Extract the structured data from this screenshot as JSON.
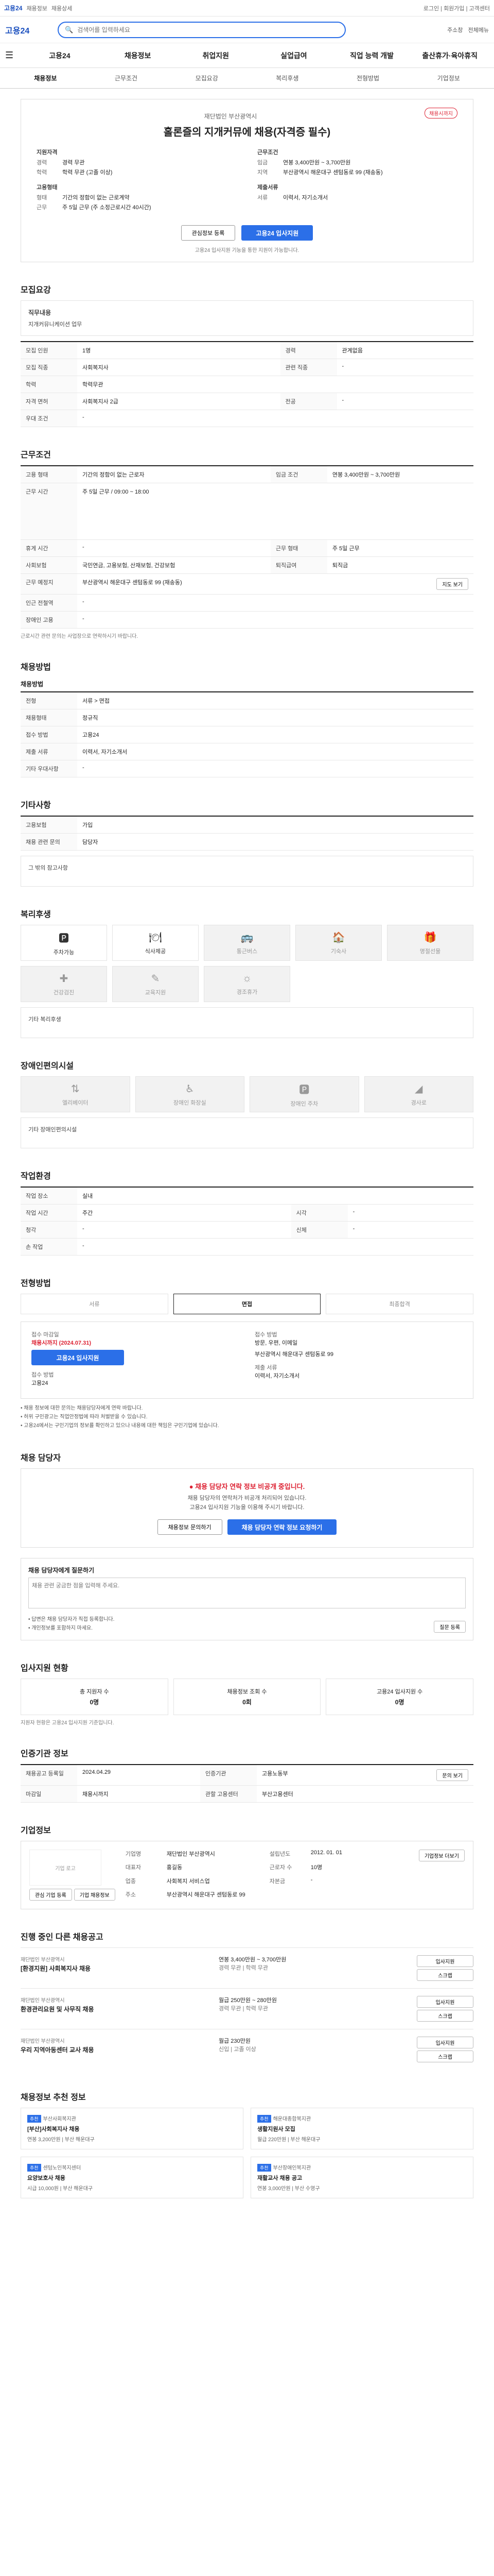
{
  "topbar": {
    "site": "고용24",
    "notice": "채용정보",
    "tab": "채용상세",
    "links": "로그인 | 회원가입 | 고객센터"
  },
  "search": {
    "brand": "고용24",
    "placeholder": "검색어를 입력하세요",
    "right1": "주소창",
    "right2": "전체메뉴"
  },
  "gnb": [
    "고용24",
    "채용정보",
    "취업지원",
    "실업급여",
    "직업 능력 개발",
    "출산휴가·육아휴직"
  ],
  "tabs": [
    "채용정보",
    "근무조건",
    "모집요강",
    "복리후생",
    "전형방법",
    "기업정보"
  ],
  "job": {
    "badge": "채용시까지",
    "company": "재단법인 부산광역시",
    "title": "홀론즐의 지개커뮤에 채용(자격증 필수)",
    "left_head": "지원자격",
    "left_rows": [
      [
        "경력",
        "경력 무관"
      ],
      [
        "학력",
        "학력 무관 (고졸 이상)"
      ]
    ],
    "right_head": "근무조건",
    "right_rows": [
      [
        "임금",
        "연봉 3,400만원 ~ 3,700만원"
      ],
      [
        "지역",
        "부산광역시 해운대구 센텀동로 99 (재송동)"
      ]
    ],
    "left2_head": "고용형태",
    "left2_rows": [
      [
        "형태",
        "기간의 정함이 없는 근로계약"
      ],
      [
        "근무",
        "주 5일 근무 (주 소정근로시간 40시간)"
      ]
    ],
    "right2_head": "제출서류",
    "right2_rows": [
      [
        "서류",
        "이력서, 자기소개서"
      ]
    ],
    "btn_scrap": "관심정보 등록",
    "btn_apply": "고용24 입사지원",
    "notice": "고용24 입사지원 기능을 통한 지원이 가능합니다."
  },
  "recruit": {
    "title": "모집요강",
    "sub1": "직무내용",
    "desc1": "지개커뮤니케이션 업무",
    "rows": [
      [
        "모집 인원",
        "1명",
        "경력",
        "관계없음"
      ],
      [
        "모집 직종",
        "사회복지사",
        "관련 직종",
        "-"
      ],
      [
        "학력",
        "학력무관",
        "",
        ""
      ],
      [
        "자격 면허",
        "사회복지사 2급",
        "전공",
        "-"
      ],
      [
        "우대 조건",
        "-",
        "",
        ""
      ]
    ]
  },
  "work": {
    "title": "근무조건",
    "rows": [
      [
        "고용 형태",
        "기간의 정함이 없는 근로자",
        "임금 조건",
        "연봉 3,400만원 ~ 3,700만원"
      ],
      [
        "근무 시간",
        "주 5일 근무 / 09:00 ~ 18:00",
        "",
        ""
      ],
      [
        "휴게 시간",
        "-",
        "근무 형태",
        "주 5일 근무"
      ],
      [
        "사회보험",
        "국민연금, 고용보험, 산재보험, 건강보험",
        "퇴직급여",
        "퇴직금"
      ],
      [
        "근무 예정지",
        "부산광역시 해운대구 센텀동로 99 (재송동)",
        "",
        ""
      ],
      [
        "인근 전철역",
        "-",
        "",
        ""
      ],
      [
        "장애인 고용",
        "-",
        "",
        ""
      ]
    ],
    "map_btn": "지도 보기",
    "note": "근로시간 관련 문의는 사업장으로 연락하시기 바랍니다."
  },
  "apply_method": {
    "title": "채용방법",
    "sub1": "채용방법",
    "rows": [
      [
        "전형",
        "서류 > 면접"
      ],
      [
        "채용형태",
        "정규직"
      ],
      [
        "접수 방법",
        "고용24"
      ],
      [
        "제출 서류",
        "이력서, 자기소개서"
      ],
      [
        "기타 우대사항",
        "-"
      ]
    ]
  },
  "other": {
    "title": "기타사항",
    "rows": [
      [
        "고용보험",
        "가입"
      ],
      [
        "채용 관련 문의",
        "담당자"
      ]
    ],
    "text": "그 밖의 참고사항"
  },
  "welfare": {
    "title": "복리후생",
    "items": [
      {
        "icon": "parking",
        "label": "주차가능",
        "on": true
      },
      {
        "icon": "meal",
        "label": "식사제공",
        "on": true
      },
      {
        "icon": "bus",
        "label": "통근버스",
        "on": false
      },
      {
        "icon": "dorm",
        "label": "기숙사",
        "on": false
      },
      {
        "icon": "gift",
        "label": "명절선물",
        "on": false
      },
      {
        "icon": "health",
        "label": "건강검진",
        "on": false
      },
      {
        "icon": "edu",
        "label": "교육지원",
        "on": false
      },
      {
        "icon": "holiday",
        "label": "경조휴가",
        "on": false
      }
    ],
    "more": "기타 복리후생"
  },
  "disability": {
    "title": "장애인편의시설",
    "items": [
      "엘리베이터",
      "장애인 화장실",
      "장애인 주차",
      "경사로"
    ],
    "more": "기타 장애인편의시설"
  },
  "workplace": {
    "title": "작업환경",
    "rows": [
      [
        "작업 장소",
        "실내",
        "",
        ""
      ],
      [
        "작업 시간",
        "주간",
        "시각",
        "-"
      ],
      [
        "청각",
        "-",
        "신체",
        "-"
      ],
      [
        "손 작업",
        "-",
        "",
        ""
      ]
    ]
  },
  "selection": {
    "title": "전형방법",
    "steps": [
      "서류",
      "면접",
      "최종합격"
    ],
    "left_label": "접수 마감일",
    "left_value": "채용시까지 (2024.07.31)",
    "left_btn": "고용24 입사지원",
    "left_method": "접수 방법",
    "left_method_val": "고용24",
    "right_label": "접수 방법",
    "right_value": "방문, 우편, 이메일",
    "right_addr": "부산광역시 해운대구 센텀동로 99",
    "right_docs": "제출 서류",
    "right_docs_val": "이력서, 자기소개서",
    "bullets": [
      "채용 정보에 대한 문의는 채용담당자에게 연락 바랍니다.",
      "허위 구인광고는 직업안정법에 따라 처벌받을 수 있습니다.",
      "고용24에서는 구인기업의 정보를 확인하고 있으나 내용에 대한 책임은 구인기업에 있습니다."
    ]
  },
  "contact": {
    "title": "채용 담당자",
    "msg": "채용 담당자 연락 정보 비공개 중입니다.",
    "sub1": "채용 담당자의 연락처가 비공개 처리되어 있습니다.",
    "sub2": "고용24 입사지원 기능을 이용해 주시기 바랍니다.",
    "btn1": "채용정보 문의하기",
    "btn2": "채용 담당자 연락 정보 요청하기"
  },
  "qna": {
    "title": "채용 담당자에게 질문하기",
    "placeholder": "채용 관련 궁금한 점을 입력해 주세요.",
    "bullets": [
      "답변은 채용 담당자가 직접 등록합니다.",
      "개인정보를 포함하지 마세요."
    ],
    "btn": "질문 등록"
  },
  "stats": {
    "title": "입사지원 현황",
    "items": [
      [
        "총 지원자 수",
        "0명"
      ],
      [
        "채용정보 조회 수",
        "0회"
      ],
      [
        "고용24 입사지원 수",
        "0명"
      ]
    ],
    "note": "지원자 현황은 고용24 입사지원 기준입니다."
  },
  "info": {
    "title": "인증기관 정보",
    "rows": [
      [
        "채용공고 등록일",
        "2024.04.29",
        "인증기관",
        "고용노동부"
      ],
      [
        "마감일",
        "채용시까지",
        "관할 고용센터",
        "부산고용센터"
      ]
    ],
    "btn": "문의 보기"
  },
  "company": {
    "title": "기업정보",
    "logo": "기업 로고",
    "name_k": "기업명",
    "name": "재단법인 부산광역시",
    "rep_k": "대표자",
    "rep": "홍길동",
    "industry_k": "업종",
    "industry": "사회복지 서비스업",
    "addr_k": "주소",
    "addr": "부산광역시 해운대구 센텀동로 99",
    "est_k": "설립년도",
    "est": "2012. 01. 01",
    "emp_k": "근로자 수",
    "emp": "10명",
    "cap_k": "자본금",
    "cap": "-",
    "btn": "기업정보 더보기",
    "btn2": "관심 기업 등록",
    "btn3": "기업 채용정보"
  },
  "jobs": {
    "title": "진행 중인 다른 채용공고",
    "rows": [
      {
        "company": "재단법인 부산광역시",
        "title": "[환경지원] 사회복지사 채용",
        "meta": "연봉 3,400만원 ~ 3,700만원",
        "meta2": "경력 무관 | 학력 무관",
        "btn1": "입사지원",
        "btn2": "스크랩"
      },
      {
        "company": "재단법인 부산광역시",
        "title": "환경관리요원 및 사무직 채용",
        "meta": "월급 250만원 ~ 280만원",
        "meta2": "경력 무관 | 학력 무관",
        "btn1": "입사지원",
        "btn2": "스크랩"
      },
      {
        "company": "재단법인 부산광역시",
        "title": "우리 지역아동센터 교사 채용",
        "meta": "월급 230만원",
        "meta2": "신입 | 고졸 이상",
        "btn1": "입사지원",
        "btn2": "스크랩"
      }
    ]
  },
  "recommend": {
    "title": "채용정보 추천 정보",
    "items": [
      {
        "tag": "추천",
        "company": "부산사회복지관",
        "title": "[부산]사회복지사 채용",
        "meta": "연봉 3,200만원 | 부산 해운대구"
      },
      {
        "tag": "추천",
        "company": "해운대종합복지관",
        "title": "생활지원사 모집",
        "meta": "월급 220만원 | 부산 해운대구"
      },
      {
        "tag": "추천",
        "company": "센텀노인복지센터",
        "title": "요양보호사 채용",
        "meta": "시급 10,000원 | 부산 해운대구"
      },
      {
        "tag": "추천",
        "company": "부산장애인복지관",
        "title": "재활교사 채용 공고",
        "meta": "연봉 3,000만원 | 부산 수영구"
      }
    ]
  }
}
